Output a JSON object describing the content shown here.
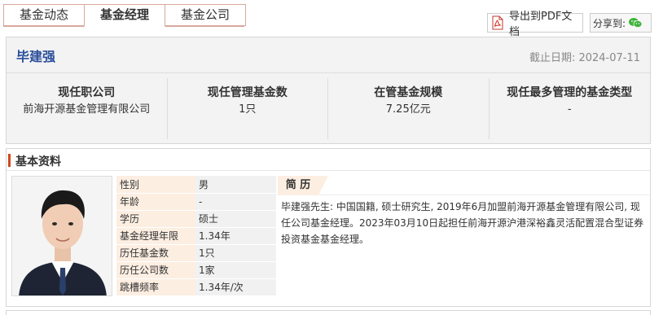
{
  "tabs": [
    {
      "label": "基金动态",
      "active": false
    },
    {
      "label": "基金经理",
      "active": true
    },
    {
      "label": "基金公司",
      "active": false
    }
  ],
  "toolbar": {
    "pdf_label": "导出到PDF文档",
    "share_label": "分享到:",
    "pdf_icon": "pdf-icon",
    "share_icon": "wechat-icon"
  },
  "manager": {
    "name": "毕建强",
    "cutoff_date": "截止日期: 2024-07-11"
  },
  "stats": [
    {
      "label": "现任职公司",
      "value": "前海开源基金管理有限公司"
    },
    {
      "label": "现任管理基金数",
      "value": "1只"
    },
    {
      "label": "在管基金规模",
      "value": "7.25亿元"
    },
    {
      "label": "现任最多管理的基金类型",
      "value": "-"
    }
  ],
  "basic_info": {
    "title": "基本资料",
    "rows": [
      {
        "key": "性别",
        "value": "男"
      },
      {
        "key": "年龄",
        "value": "-"
      },
      {
        "key": "学历",
        "value": "硕士"
      },
      {
        "key": "基金经理年限",
        "value": "1.34年"
      },
      {
        "key": "历任基金数",
        "value": "1只"
      },
      {
        "key": "历任公司数",
        "value": "1家"
      },
      {
        "key": "跳槽频率",
        "value": "1.34年/次"
      }
    ],
    "bio_title": "简 历",
    "bio_text": "毕建强先生: 中国国籍, 硕士研究生, 2019年6月加盟前海开源基金管理有限公司, 现任公司基金经理。2023年03月10日起担任前海开源沪港深裕鑫灵活配置混合型证券投资基金基金经理。"
  },
  "colors": {
    "accent": "#d2481b",
    "name_blue": "#2a4f9c",
    "tab_border": "#d9a79b",
    "key_bg": "#fdeee2"
  }
}
